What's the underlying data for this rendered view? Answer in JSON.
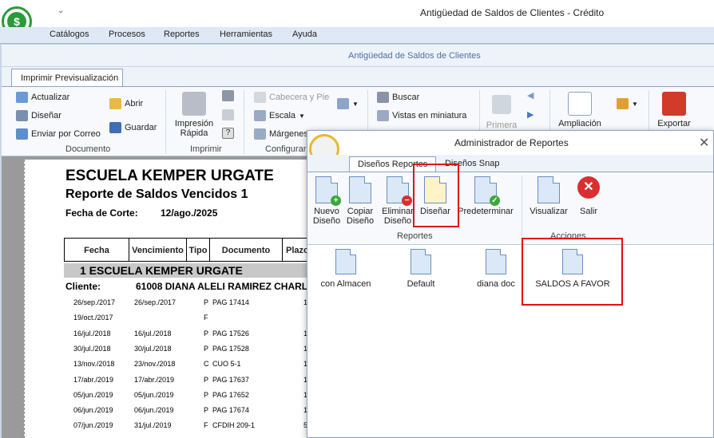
{
  "window": {
    "title": "Antigüedad de Saldos de Clientes - Crédito",
    "qat": "⌄"
  },
  "menu": [
    "Catálogos",
    "Procesos",
    "Reportes",
    "Herramientas",
    "Ayuda"
  ],
  "child_window": {
    "title": "Antigüedad de Saldos de Clientes"
  },
  "ribbon": {
    "tab": "Imprimir Previsualización",
    "documento": {
      "label": "Documento",
      "actualizar": "Actualizar",
      "disenar": "Diseñar",
      "enviar": "Enviar por Correo",
      "abrir": "Abrir",
      "guardar": "Guardar"
    },
    "imprimir": {
      "label": "Imprimir",
      "rapida1": "Impresión",
      "rapida2": "Rápida"
    },
    "configurar": {
      "label": "Configurar",
      "cabecera": "Cabecera y Pie",
      "escala": "Escala",
      "margenes": "Márgenes"
    },
    "navegacion": {
      "buscar": "Buscar",
      "miniatura": "Vistas en miniatura",
      "primera": "Primera"
    },
    "ampliacion": "Ampliación",
    "exportar": "Exportar"
  },
  "report": {
    "company": "ESCUELA KEMPER URGATE",
    "subtitle": "Reporte de Saldos Vencidos  1",
    "cut_label": "Fecha de Corte:",
    "cut_date": "12/ago./2025",
    "headers": [
      "Fecha",
      "Vencimiento",
      "Tipo",
      "Documento",
      "Plazo"
    ],
    "group": "1 ESCUELA KEMPER URGATE",
    "client_label": "Cliente:",
    "client": "61008  DIANA ALELI RAMIREZ CHARL",
    "rows": [
      {
        "fecha": "26/sep./2017",
        "venc": "26/sep./2017",
        "tipo": "P",
        "doc": "PAG 17414",
        "plazo": "1"
      },
      {
        "fecha": "19/oct./2017",
        "venc": "",
        "tipo": "F",
        "doc": "",
        "plazo": ""
      },
      {
        "fecha": "16/jul./2018",
        "venc": "16/jul./2018",
        "tipo": "P",
        "doc": "PAG 17526",
        "plazo": "1"
      },
      {
        "fecha": "30/jul./2018",
        "venc": "30/jul./2018",
        "tipo": "P",
        "doc": "PAG 17528",
        "plazo": "1"
      },
      {
        "fecha": "13/nov./2018",
        "venc": "23/nov./2018",
        "tipo": "C",
        "doc": "CUO 5-1",
        "plazo": "1"
      },
      {
        "fecha": "17/abr./2019",
        "venc": "17/abr./2019",
        "tipo": "P",
        "doc": "PAG 17637",
        "plazo": "1"
      },
      {
        "fecha": "05/jun./2019",
        "venc": "05/jun./2019",
        "tipo": "P",
        "doc": "PAG 17652",
        "plazo": "1"
      },
      {
        "fecha": "06/jun./2019",
        "venc": "06/jun./2019",
        "tipo": "P",
        "doc": "PAG 17674",
        "plazo": "1"
      },
      {
        "fecha": "07/jun./2019",
        "venc": "31/jul./2019",
        "tipo": "F",
        "doc": "CFDIH 209-1",
        "plazo": "5"
      }
    ]
  },
  "dialog": {
    "title": "Administrador de Reportes",
    "tabs": [
      "Diseños Reportes",
      "Diseños Snap"
    ],
    "buttons": {
      "nuevo": "Nuevo Diseño",
      "copiar": "Copiar Diseño",
      "eliminar": "Eliminar Diseño",
      "disenar": "Diseñar",
      "predeterminar": "Predeterminar",
      "visualizar": "Visualizar",
      "salir": "Salir"
    },
    "groups": {
      "reportes": "Reportes",
      "acciones": "Acciones"
    },
    "files": [
      "con Almacen",
      "Default",
      "diana doc",
      "SALDOS A FAVOR"
    ]
  },
  "colors": {
    "highlight": "#e01010",
    "accent": "#4a6fa5"
  }
}
